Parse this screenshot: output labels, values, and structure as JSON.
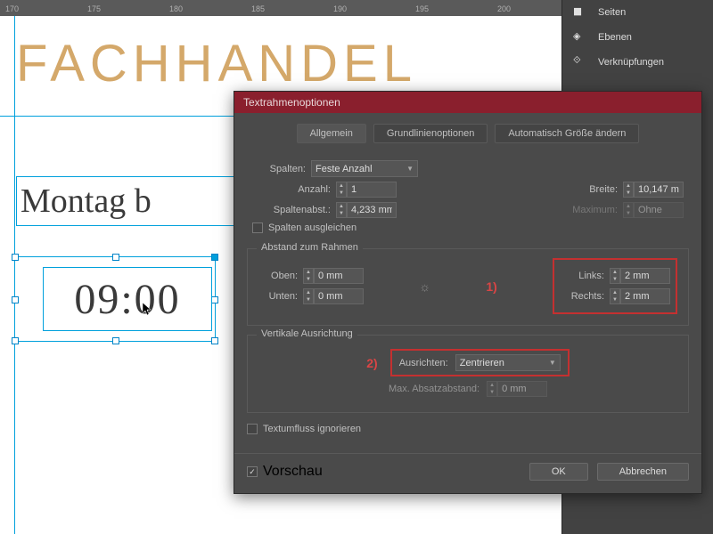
{
  "ruler": {
    "marks": [
      "170",
      "175",
      "180",
      "185",
      "190",
      "195",
      "200"
    ]
  },
  "side_panel": {
    "pages": "Seiten",
    "layers": "Ebenen",
    "links": "Verknüpfungen"
  },
  "canvas": {
    "heading": "FACHHANDEL",
    "line1": "Montag b",
    "line2": "09:00"
  },
  "dialog": {
    "title": "Textrahmenoptionen",
    "tabs": {
      "general": "Allgemein",
      "baseline": "Grundlinienoptionen",
      "autosize": "Automatisch Größe ändern"
    },
    "columns": {
      "label": "Spalten:",
      "type": "Feste Anzahl",
      "count_label": "Anzahl:",
      "count": "1",
      "width_label": "Breite:",
      "width": "10,147 m",
      "gutter_label": "Spaltenabst.:",
      "gutter": "4,233 mm",
      "max_label": "Maximum:",
      "max": "Ohne",
      "balance": "Spalten ausgleichen"
    },
    "inset": {
      "legend": "Abstand zum Rahmen",
      "top_label": "Oben:",
      "top": "0 mm",
      "bottom_label": "Unten:",
      "bottom": "0 mm",
      "left_label": "Links:",
      "left": "2 mm",
      "right_label": "Rechts:",
      "right": "2 mm"
    },
    "valign": {
      "legend": "Vertikale Ausrichtung",
      "align_label": "Ausrichten:",
      "align": "Zentrieren",
      "max_para_label": "Max. Absatzabstand:",
      "max_para": "0 mm"
    },
    "ignore_wrap": "Textumfluss ignorieren",
    "preview": "Vorschau",
    "ok": "OK",
    "cancel": "Abbrechen",
    "anno1": "1)",
    "anno2": "2)"
  }
}
